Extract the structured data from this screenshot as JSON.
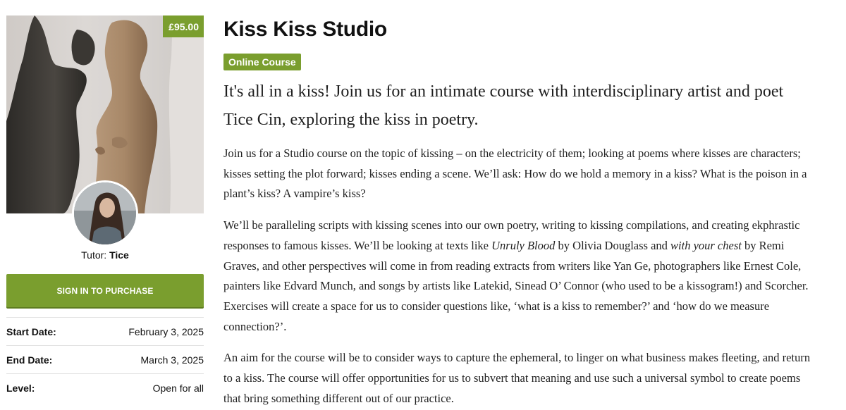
{
  "course": {
    "price": "£95.00",
    "tutor_prefix": "Tutor:",
    "tutor_name": "Tice",
    "sign_in_label": "SIGN IN TO PURCHASE",
    "details": [
      {
        "label": "Start Date:",
        "value": "February 3, 2025"
      },
      {
        "label": "End Date:",
        "value": "March 3, 2025"
      },
      {
        "label": "Level:",
        "value": "Open for all"
      }
    ]
  },
  "content": {
    "title": "Kiss Kiss Studio",
    "tag": "Online Course",
    "lead": "It's all in a kiss! Join us for an intimate course with interdisciplinary artist and poet Tice Cin, exploring the kiss in poetry.",
    "p1": "Join us for a Studio course on the topic of kissing – on the electricity of them; looking at poems where kisses are characters; kisses setting the plot forward; kisses ending a scene. We’ll ask: How do we hold a memory in a kiss? What is the poison in a plant’s kiss? A vampire’s kiss?",
    "p2": {
      "a": "We’ll be paralleling scripts with kissing scenes into our own poetry, writing to kissing compilations, and creating ekphrastic responses to famous kisses. We’ll be looking at texts like ",
      "b": "Unruly Blood",
      "c": " by Olivia Douglass and ",
      "d": "with your chest",
      "e": " by Remi Graves, and other perspectives will come in from reading extracts from writers like Yan Ge, photographers like Ernest Cole, painters like Edvard Munch, and songs by artists like Latekid, Sinead O’ Connor (who used to be a kissogram!) and Scorcher. Exercises will create a space for us to consider questions like, ‘what is a kiss to remember?’ and ‘how do we measure connection?’."
    },
    "p3": "An aim for the course will be to consider ways to capture the ephemeral, to linger on what business makes fleeting, and return to a kiss. The course will offer opportunities for us to subvert that meaning and use such a universal symbol to create poems that bring something different out of our practice."
  },
  "colors": {
    "accent": "#7a9e2e"
  },
  "icons": {
    "hero": "mannequins-photo",
    "avatar": "tutor-avatar-photo"
  }
}
